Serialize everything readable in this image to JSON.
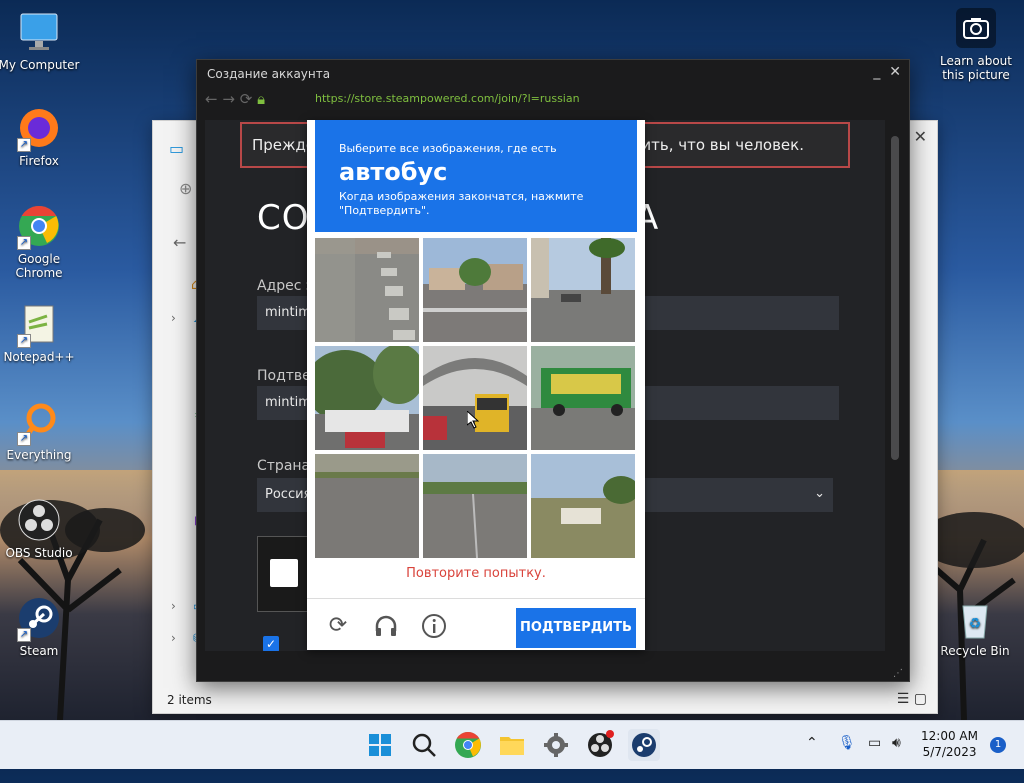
{
  "desktop": {
    "icons": [
      {
        "label": "My Computer"
      },
      {
        "label": "Firefox"
      },
      {
        "label": "Google Chrome"
      },
      {
        "label": "Notepad++"
      },
      {
        "label": "Everything"
      },
      {
        "label": "OBS Studio"
      },
      {
        "label": "Steam"
      },
      {
        "label": "Recycle Bin"
      }
    ],
    "learn_picture": "Learn about this picture"
  },
  "explorer": {
    "status": "2 items"
  },
  "steam_window": {
    "title": "Создание аккаунта",
    "url": "https://store.steampowered.com/join/?l=russian",
    "notice_left": "Прежде",
    "notice_right": "рдить, что вы человек.",
    "heading_left": "СО",
    "heading_right": "А",
    "email_label": "Адрес э",
    "email_value": "mintimu",
    "confirm_label": "Подтвер",
    "confirm_value": "mintimu",
    "country_label": "Страна",
    "country_value": "Россия"
  },
  "captcha": {
    "prompt": "Выберите все изображения, где есть",
    "target": "автобус",
    "instructions": "Когда изображения закончатся, нажмите \"Подтвердить\".",
    "error": "Повторите попытку.",
    "verify_label": "ПОДТВЕРДИТЬ",
    "tiles": [
      "crosswalk",
      "street-houses",
      "road-palms",
      "truck-trees",
      "school-bus",
      "food-truck",
      "road-grass",
      "road-field",
      "field-sign"
    ]
  },
  "taskbar": {
    "time": "12:00 AM",
    "date": "5/7/2023",
    "notifications": "1"
  },
  "colors": {
    "accent": "#1a73e8",
    "error": "#d9433b",
    "url_green": "#7fbf3f"
  }
}
